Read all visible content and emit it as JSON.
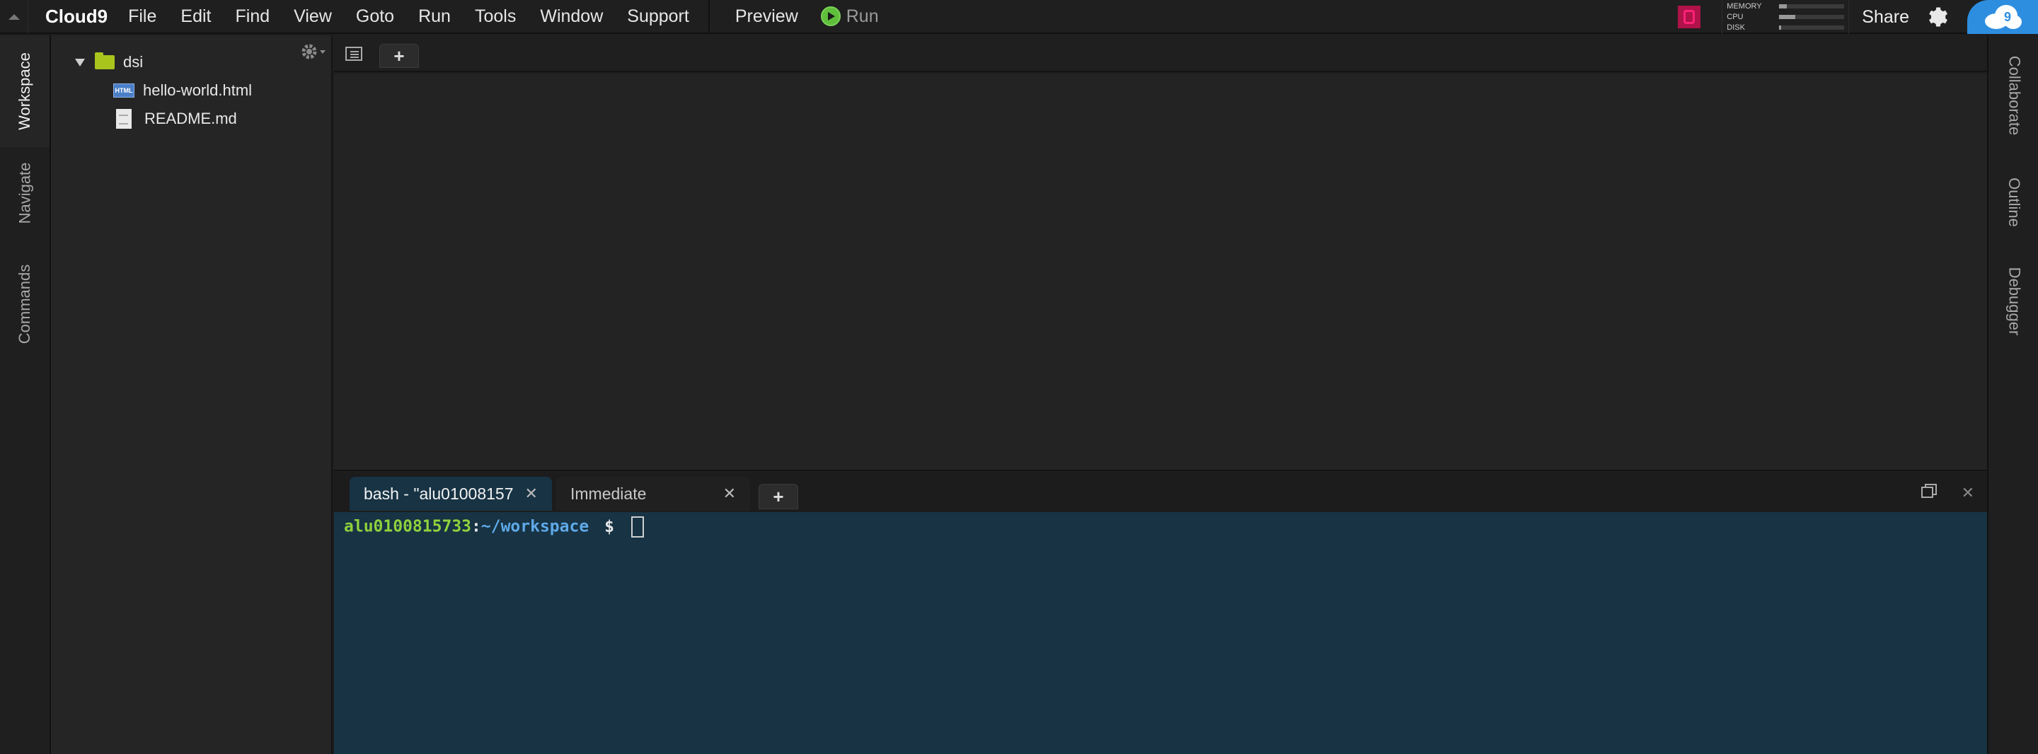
{
  "menubar": {
    "brand": "Cloud9",
    "items": [
      "File",
      "Edit",
      "Find",
      "View",
      "Goto",
      "Run",
      "Tools",
      "Window",
      "Support"
    ],
    "preview_label": "Preview",
    "run_label": "Run",
    "share_label": "Share",
    "meters": [
      {
        "label": "MEMORY",
        "level": 0.12
      },
      {
        "label": "CPU",
        "level": 0.25
      },
      {
        "label": "DISK",
        "level": 0.03
      }
    ]
  },
  "left_panels": [
    "Workspace",
    "Navigate",
    "Commands"
  ],
  "right_panels": [
    "Collaborate",
    "Outline",
    "Debugger"
  ],
  "tree": {
    "folder": "dsi",
    "files": [
      {
        "name": "hello-world.html",
        "icon": "html-file-icon",
        "badge": "HTML"
      },
      {
        "name": "README.md",
        "icon": "text-file-icon"
      }
    ]
  },
  "console": {
    "tabs": [
      {
        "label": "bash - \"alu01008157",
        "active": true
      },
      {
        "label": "Immediate",
        "active": false
      }
    ],
    "prompt": {
      "user": "alu0100815733",
      "sep": ":",
      "path": "~/workspace",
      "sign": "$"
    }
  },
  "colors": {
    "terminal_bg": "#173344",
    "run_green": "#5fbf3b",
    "folder": "#a9c41c",
    "cloud_badge": "#2d8ee0"
  }
}
